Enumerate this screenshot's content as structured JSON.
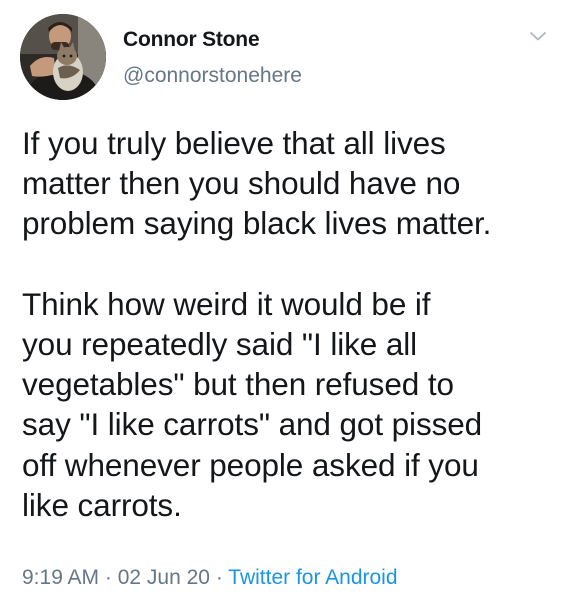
{
  "tweet": {
    "display_name": "Connor Stone",
    "handle": "@connorstonehere",
    "avatar_icon": "profile-photo-with-cat",
    "more_icon": "chevron-down-icon",
    "text_lines": [
      "If you truly believe that all lives",
      "matter then you should have no",
      "problem saying black lives matter.",
      "",
      "Think how weird it would be if",
      "you repeatedly said \"I like all",
      "vegetables\" but then refused to",
      "say \"I like carrots\" and got pissed",
      "off whenever people asked if you",
      "like carrots."
    ],
    "time": "9:19 AM",
    "separator_1": " · ",
    "date": "02 Jun 20",
    "separator_2": " · ",
    "source": "Twitter for Android",
    "colors": {
      "text": "#14171a",
      "secondary": "#657786",
      "link": "#1b95e0"
    }
  }
}
